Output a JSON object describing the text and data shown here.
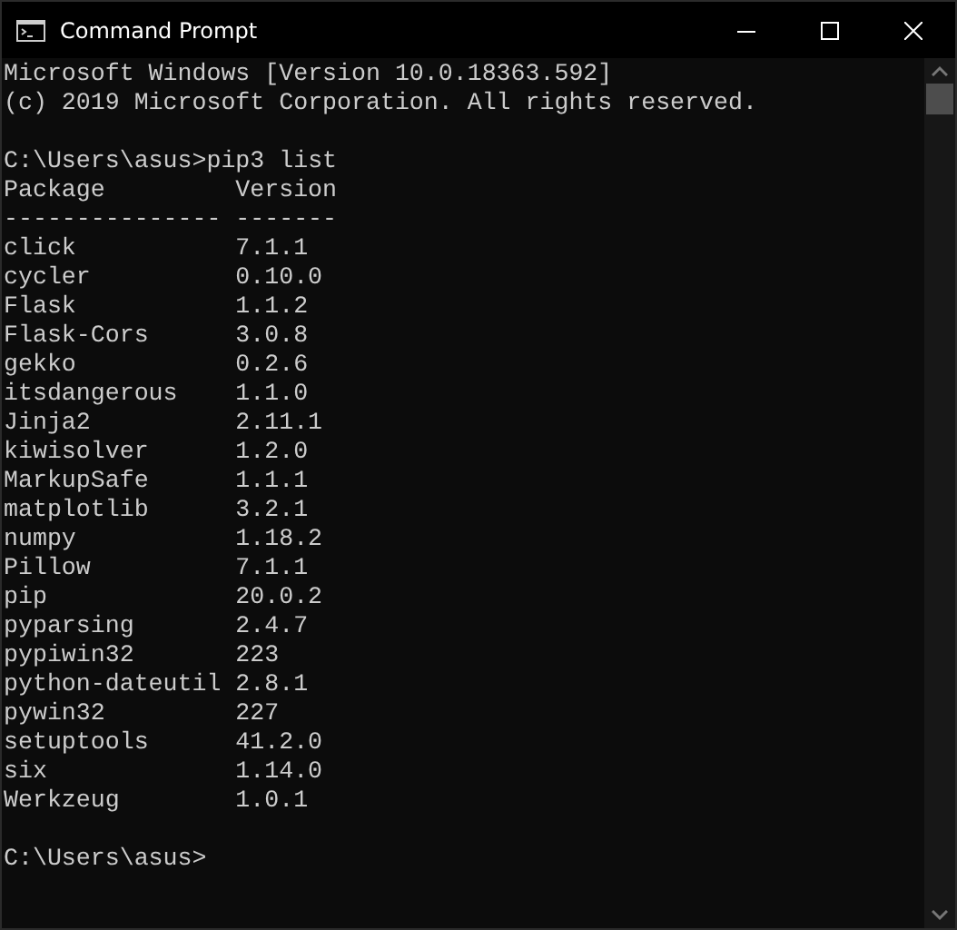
{
  "window": {
    "title": "Command Prompt"
  },
  "console": {
    "banner": [
      "Microsoft Windows [Version 10.0.18363.592]",
      "(c) 2019 Microsoft Corporation. All rights reserved."
    ],
    "command": "C:\\Users\\asus>pip3 list",
    "table": {
      "columns": [
        "Package",
        "Version"
      ],
      "separators": [
        "---------------",
        "-------"
      ],
      "rows": [
        {
          "package": "click",
          "version": "7.1.1"
        },
        {
          "package": "cycler",
          "version": "0.10.0"
        },
        {
          "package": "Flask",
          "version": "1.1.2"
        },
        {
          "package": "Flask-Cors",
          "version": "3.0.8"
        },
        {
          "package": "gekko",
          "version": "0.2.6"
        },
        {
          "package": "itsdangerous",
          "version": "1.1.0"
        },
        {
          "package": "Jinja2",
          "version": "2.11.1"
        },
        {
          "package": "kiwisolver",
          "version": "1.2.0"
        },
        {
          "package": "MarkupSafe",
          "version": "1.1.1"
        },
        {
          "package": "matplotlib",
          "version": "3.2.1"
        },
        {
          "package": "numpy",
          "version": "1.18.2"
        },
        {
          "package": "Pillow",
          "version": "7.1.1"
        },
        {
          "package": "pip",
          "version": "20.0.2"
        },
        {
          "package": "pyparsing",
          "version": "2.4.7"
        },
        {
          "package": "pypiwin32",
          "version": "223"
        },
        {
          "package": "python-dateutil",
          "version": "2.8.1"
        },
        {
          "package": "pywin32",
          "version": "227"
        },
        {
          "package": "setuptools",
          "version": "41.2.0"
        },
        {
          "package": "six",
          "version": "1.14.0"
        },
        {
          "package": "Werkzeug",
          "version": "1.0.1"
        }
      ]
    },
    "prompt": "C:\\Users\\asus>"
  }
}
